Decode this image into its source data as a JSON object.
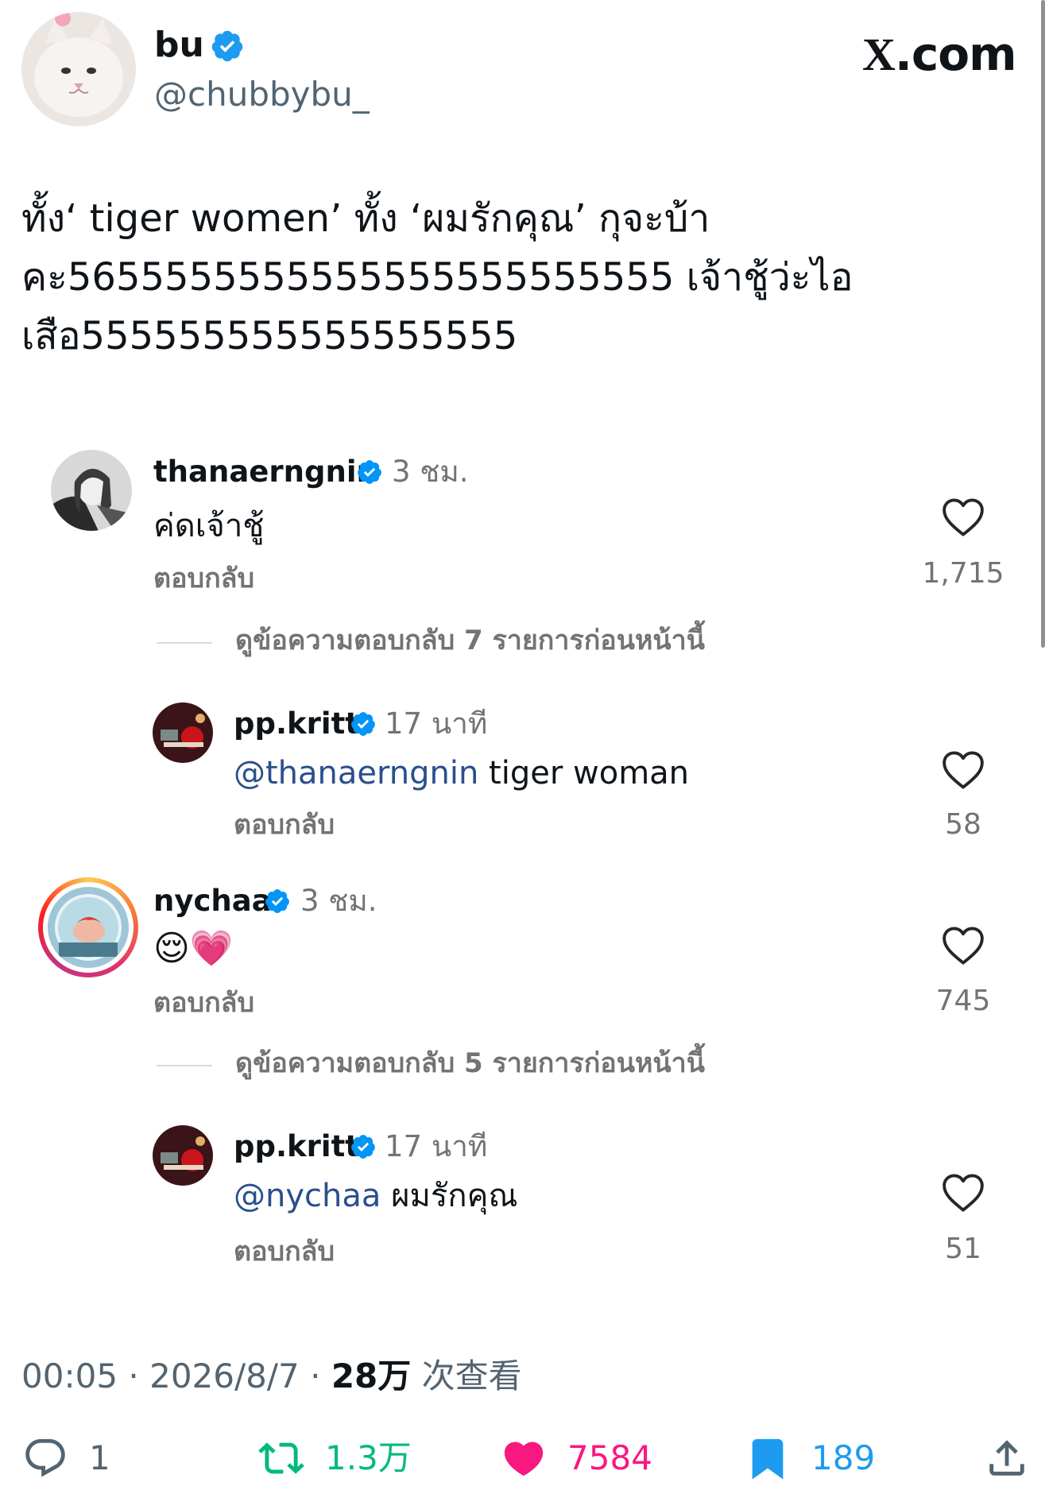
{
  "author": {
    "name": "bu",
    "handle": "@chubbybu_",
    "verified_color": "#1d9bf0"
  },
  "site_label": {
    "x": "X",
    "rest": ".com"
  },
  "tweet": {
    "lines": [
      "ทั้ง‘ tiger women’ ทั้ง ‘ผมรักคุณ’ กุจะบ้า",
      "คะ5655555555555555555555555 เจ้าชู้ว่ะไอ",
      "เสือ555555555555555555"
    ]
  },
  "comments": [
    {
      "user": "thanaerngnin",
      "time": "3 ชม.",
      "text": "ค่ดเจ้าชู้",
      "reply_label": "ตอบกลับ",
      "likes": "1,715",
      "more_replies": "ดูข้อความตอบกลับ 7 รายการก่อนหน้านี้",
      "reply": {
        "user": "pp.kritt",
        "time": "17 นาที",
        "mention": "@thanaerngnin",
        "text": " tiger woman",
        "reply_label": "ตอบกลับ",
        "likes": "58"
      }
    },
    {
      "user": "nychaa",
      "time": "3 ชม.",
      "text": "😌💗",
      "reply_label": "ตอบกลับ",
      "likes": "745",
      "more_replies": "ดูข้อความตอบกลับ 5 รายการก่อนหน้านี้",
      "reply": {
        "user": "pp.kritt",
        "time": "17 นาที",
        "mention": "@nychaa",
        "text": " ผมรักคุณ",
        "reply_label": "ตอบกลับ",
        "likes": "51"
      }
    }
  ],
  "meta": {
    "time": "00:05",
    "date": "2026/8/7",
    "views": "28万",
    "views_label": "次查看"
  },
  "actions": {
    "replies": "1",
    "retweets": "1.3万",
    "likes": "7584",
    "bookmarks": "189"
  },
  "colors": {
    "retweet": "#00ba7c",
    "like": "#f91880",
    "bookmark": "#1d9bf0",
    "ig_verified": "#0095f6"
  }
}
